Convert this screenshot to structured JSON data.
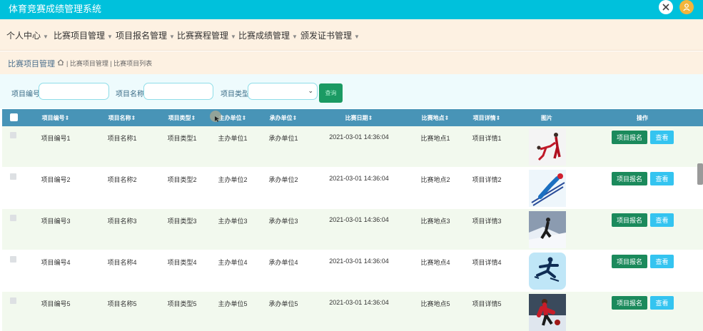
{
  "header": {
    "title": "体育竞赛成绩管理系统",
    "close_icon": "close-x-icon",
    "user_icon": "user-avatar-icon"
  },
  "nav": [
    {
      "label": "个人中心"
    },
    {
      "label": "比赛项目管理"
    },
    {
      "label": "项目报名管理"
    },
    {
      "label": "比赛赛程管理"
    },
    {
      "label": "比赛成绩管理"
    },
    {
      "label": "颁发证书管理"
    }
  ],
  "breadcrumb": {
    "title": "比赛项目管理",
    "home_icon": "home-icon",
    "trail": "| 比赛项目管理 | 比赛项目列表"
  },
  "search": {
    "field1_label": "项目编号",
    "field1_value": "",
    "field1_placeholder": "",
    "field2_label": "项目名称",
    "field2_value": "",
    "field2_placeholder": "",
    "field3_label": "项目类型",
    "field3_value": "",
    "button_label": "查询"
  },
  "table": {
    "headers": [
      "项目编号⇕",
      "项目名称⇕",
      "项目类型⇕",
      "主办单位⇕",
      "承办单位⇕",
      "比赛日期⇕",
      "比赛地点⇕",
      "项目详情⇕",
      "图片",
      "操作"
    ],
    "rows": [
      {
        "id": "项目编号1",
        "name": "项目名称1",
        "type": "项目类型1",
        "host": "主办单位1",
        "organizer": "承办单位1",
        "date": "2021-03-01 14:36:04",
        "place": "比赛地点1",
        "detail": "项目详情1",
        "apply": "项目报名",
        "view": "查看"
      },
      {
        "id": "项目编号2",
        "name": "项目名称2",
        "type": "项目类型2",
        "host": "主办单位2",
        "organizer": "承办单位2",
        "date": "2021-03-01 14:36:04",
        "place": "比赛地点2",
        "detail": "项目详情2",
        "apply": "项目报名",
        "view": "查看"
      },
      {
        "id": "项目编号3",
        "name": "项目名称3",
        "type": "项目类型3",
        "host": "主办单位3",
        "organizer": "承办单位3",
        "date": "2021-03-01 14:36:04",
        "place": "比赛地点3",
        "detail": "项目详情3",
        "apply": "项目报名",
        "view": "查看"
      },
      {
        "id": "项目编号4",
        "name": "项目名称4",
        "type": "项目类型4",
        "host": "主办单位4",
        "organizer": "承办单位4",
        "date": "2021-03-01 14:36:04",
        "place": "比赛地点4",
        "detail": "项目详情4",
        "apply": "项目报名",
        "view": "查看"
      },
      {
        "id": "项目编号5",
        "name": "项目名称5",
        "type": "项目类型5",
        "host": "主办单位5",
        "organizer": "承办单位5",
        "date": "2021-03-01 14:36:04",
        "place": "比赛地点5",
        "detail": "项目详情5",
        "apply": "项目报名",
        "view": "查看"
      }
    ]
  },
  "colors": {
    "header": "#00c1dc",
    "nav_bg": "#fdf1e2",
    "table_head": "#4894b7",
    "apply_btn": "#1b8a5c",
    "view_btn": "#34c4f0"
  }
}
